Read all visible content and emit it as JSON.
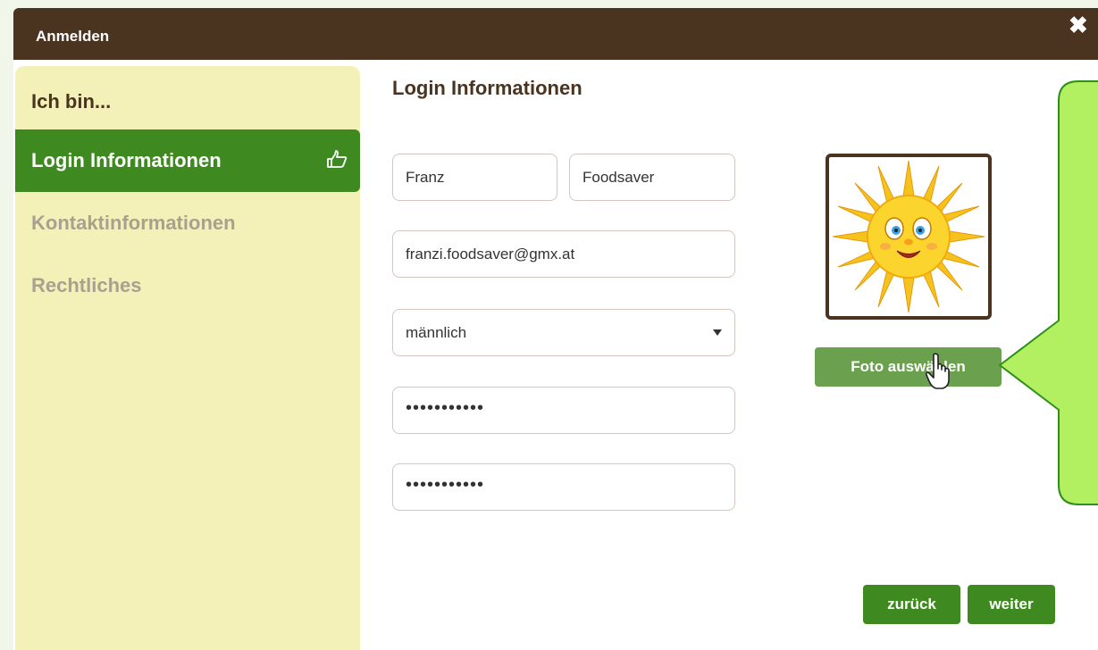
{
  "window": {
    "title": "Anmelden",
    "close_icon": "close-icon"
  },
  "sidebar": {
    "heading": "Ich bin...",
    "items": [
      {
        "label": "Login Informationen",
        "active": true,
        "icon": "pointing-hand-icon"
      },
      {
        "label": "Kontaktinformationen",
        "active": false
      },
      {
        "label": "Rechtliches",
        "active": false
      }
    ]
  },
  "main": {
    "title": "Login Informationen",
    "first_name": "Franz",
    "last_name": "Foodsaver",
    "email": "franzi.foodsaver@gmx.at",
    "gender": "männlich",
    "password": "•••••••••••",
    "password_repeat": "•••••••••••"
  },
  "photo": {
    "image": "sun-smiley-image",
    "button_label": "Foto auswählen"
  },
  "nav": {
    "back_label": "zurück",
    "next_label": "weiter"
  },
  "colors": {
    "titlebar": "#4a3420",
    "accent_green": "#3f8a20",
    "sidebar_bg": "#f4f1b8",
    "callout": "#b2f062"
  }
}
